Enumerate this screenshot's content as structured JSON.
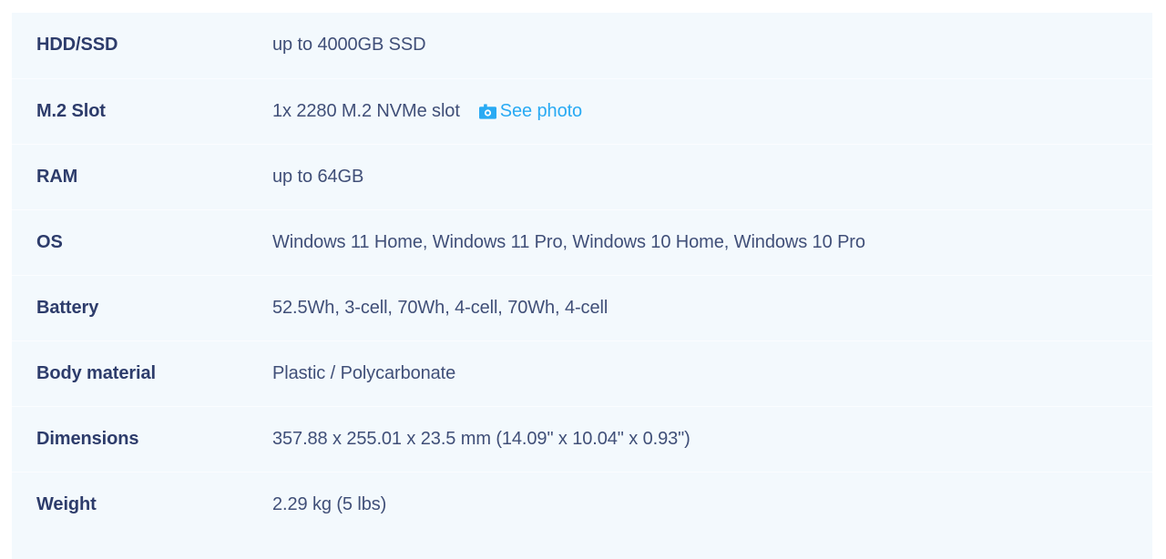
{
  "panel": {
    "background_color": "#f3f9fd",
    "divider_color": "#fbfdff",
    "label_color": "#2d3c6b",
    "value_color": "#404f78",
    "link_color": "#29aaf3"
  },
  "spec_rows": [
    {
      "label": "HDD/SSD",
      "value": "up to 4000GB SSD"
    },
    {
      "label": "M.2 Slot",
      "value": "1x 2280 M.2 NVMe slot",
      "link": {
        "icon": "camera-icon",
        "label": "See photo"
      }
    },
    {
      "label": "RAM",
      "value": "up to 64GB"
    },
    {
      "label": "OS",
      "value": "Windows 11 Home, Windows 11 Pro, Windows 10 Home, Windows 10 Pro"
    },
    {
      "label": "Battery",
      "value": "52.5Wh, 3-cell, 70Wh, 4-cell, 70Wh, 4-cell"
    },
    {
      "label": "Body material",
      "value": "Plastic / Polycarbonate"
    },
    {
      "label": "Dimensions",
      "value": "357.88 x 255.01 x 23.5 mm (14.09\" x 10.04\" x 0.93\")"
    },
    {
      "label": "Weight",
      "value": "2.29 kg (5 lbs)"
    }
  ]
}
